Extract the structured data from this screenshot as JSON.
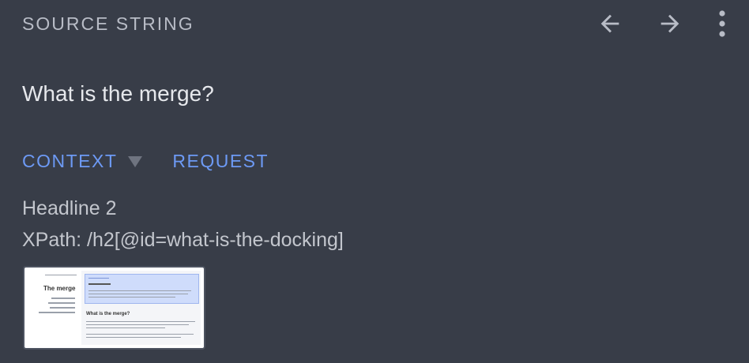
{
  "header": {
    "label": "SOURCE STRING",
    "icons": [
      "arrow-back-icon",
      "arrow-forward-icon",
      "more-vert-icon"
    ]
  },
  "source": {
    "text": "What is the merge?"
  },
  "tabs": {
    "context_label": "CONTEXT",
    "request_label": "REQUEST"
  },
  "context": {
    "element_type": "Headline 2",
    "xpath": "XPath: /h2[@id=what-is-the-docking]"
  },
  "screenshot": {
    "title": "The merge",
    "heading": "What is the merge?"
  },
  "colors": {
    "background": "#383d48",
    "accent": "#6d9af5"
  }
}
